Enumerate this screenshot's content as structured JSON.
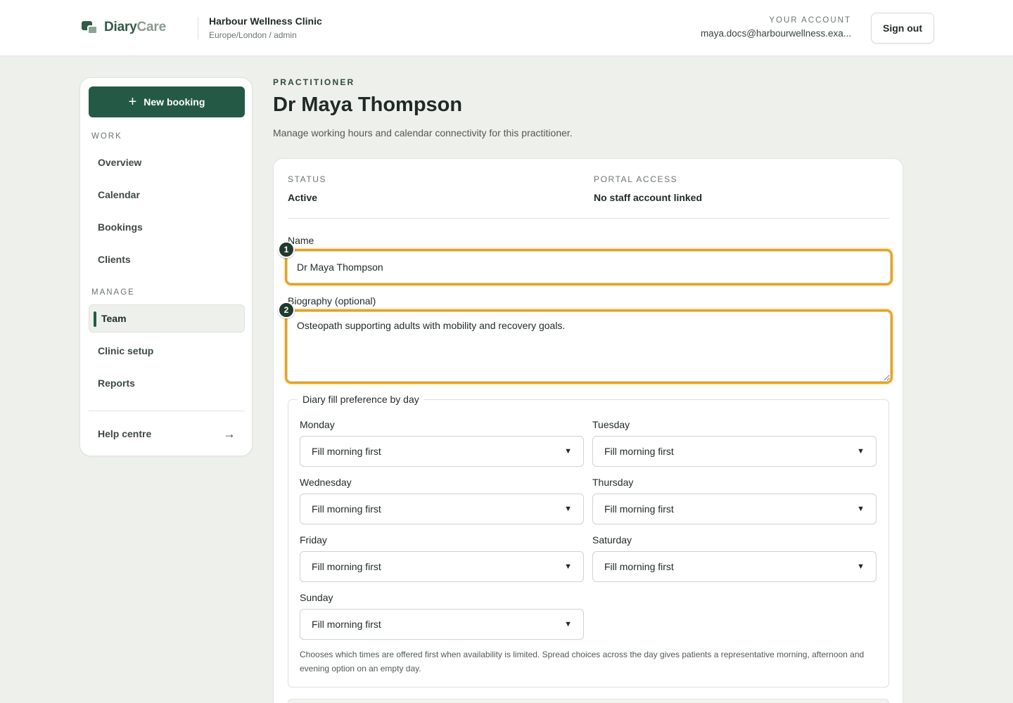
{
  "brand": {
    "name_part1": "Diary",
    "name_part2": "Care"
  },
  "clinic": {
    "name": "Harbour Wellness Clinic",
    "sub": "Europe/London / admin"
  },
  "account": {
    "label": "YOUR ACCOUNT",
    "email": "maya.docs@harbourwellness.exa...",
    "signout_label": "Sign out"
  },
  "sidebar": {
    "new_booking_label": "New booking",
    "sections": {
      "work": "WORK",
      "manage": "MANAGE"
    },
    "items": [
      {
        "label": "Overview"
      },
      {
        "label": "Calendar"
      },
      {
        "label": "Bookings"
      },
      {
        "label": "Clients"
      },
      {
        "label": "Team",
        "active": true
      },
      {
        "label": "Clinic setup"
      },
      {
        "label": "Reports"
      }
    ],
    "help_label": "Help centre"
  },
  "page": {
    "eyebrow": "PRACTITIONER",
    "title": "Dr Maya Thompson",
    "description": "Manage working hours and calendar connectivity for this practitioner."
  },
  "meta": {
    "status_label": "STATUS",
    "status_value": "Active",
    "portal_label": "PORTAL ACCESS",
    "portal_value": "No staff account linked"
  },
  "form": {
    "name_label": "Name",
    "name_value": "Dr Maya Thompson",
    "bio_label": "Biography (optional)",
    "bio_value": "Osteopath supporting adults with mobility and recovery goals.",
    "markers": [
      "1",
      "2"
    ],
    "diary_legend": "Diary fill preference by day",
    "days": [
      {
        "day": "Monday",
        "value": "Fill morning first"
      },
      {
        "day": "Tuesday",
        "value": "Fill morning first"
      },
      {
        "day": "Wednesday",
        "value": "Fill morning first"
      },
      {
        "day": "Thursday",
        "value": "Fill morning first"
      },
      {
        "day": "Friday",
        "value": "Fill morning first"
      },
      {
        "day": "Saturday",
        "value": "Fill morning first"
      },
      {
        "day": "Sunday",
        "value": "Fill morning first"
      }
    ],
    "hint": "Chooses which times are offered first when availability is limited. Spread choices across the day gives patients a representative morning, afternoon and evening option on an empty day."
  },
  "colors": {
    "accent": "#245a45",
    "highlight": "#e8a317",
    "background": "#eef0eb"
  }
}
